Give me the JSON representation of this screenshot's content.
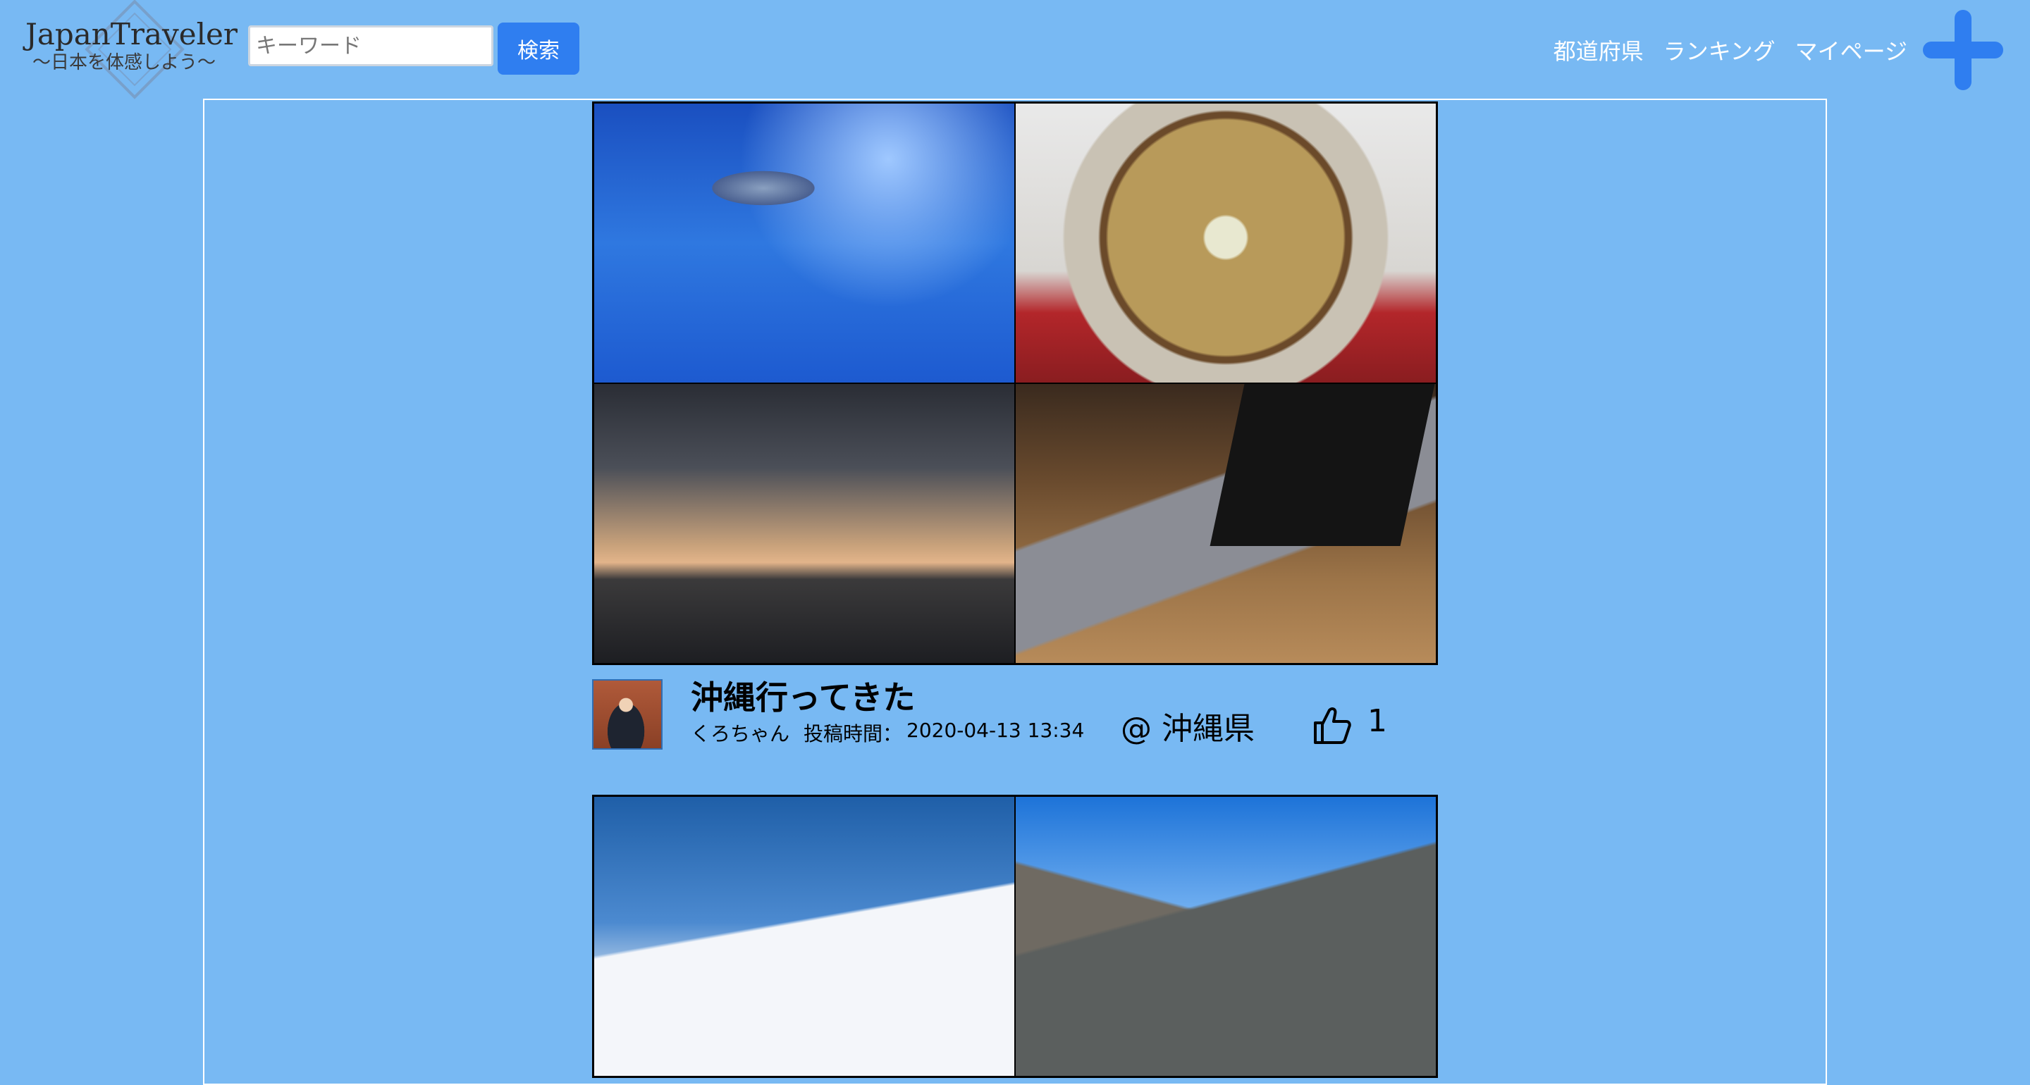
{
  "header": {
    "brand": "JapanTraveler",
    "tagline": "～日本を体感しよう～",
    "search": {
      "placeholder": "キーワード",
      "value": "",
      "button_label": "検索"
    },
    "nav": [
      {
        "label": "都道府県"
      },
      {
        "label": "ランキング"
      },
      {
        "label": "マイページ"
      }
    ],
    "add_icon": "plus-icon",
    "accent_color": "#2f7ef0",
    "background_color": "#78b9f3"
  },
  "posts": [
    {
      "title": "沖縄行ってきた",
      "author": "くろちゃん",
      "time_label": "投稿時間：",
      "time": "2020-04-13 13:34",
      "location": "@ 沖縄県",
      "like_icon": "thumbs-up-icon",
      "likes": "1",
      "photos": [
        "aquarium-photo",
        "soba-photo",
        "sunset-photo",
        "laptop-photo"
      ]
    },
    {
      "photos": [
        "snow-mountain-photo",
        "mountain-ridge-photo"
      ]
    }
  ]
}
